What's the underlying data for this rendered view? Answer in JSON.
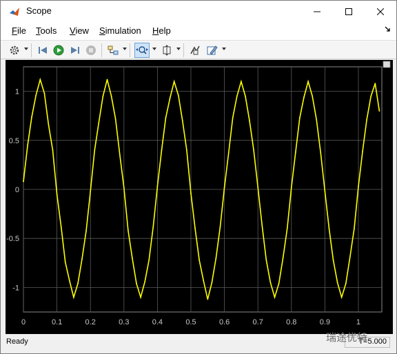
{
  "window": {
    "title": "Scope"
  },
  "menu": [
    {
      "label": "File",
      "underline": "F",
      "rest": "ile"
    },
    {
      "label": "Tools",
      "underline": "T",
      "rest": "ools"
    },
    {
      "label": "View",
      "underline": "V",
      "rest": "iew"
    },
    {
      "label": "Simulation",
      "underline": "S",
      "rest": "imulation"
    },
    {
      "label": "Help",
      "underline": "H",
      "rest": "elp"
    }
  ],
  "toolbar": {
    "icons": [
      "settings-icon",
      "step-back-icon",
      "run-icon",
      "step-forward-icon",
      "stop-icon",
      "signal-selector-icon",
      "zoom-icon",
      "scale-axes-icon",
      "cursor-measure-icon",
      "style-icon"
    ]
  },
  "chart_data": {
    "type": "line",
    "title": "",
    "xlabel": "",
    "ylabel": "",
    "xlim": [
      0,
      1.07
    ],
    "ylim": [
      -1.25,
      1.25
    ],
    "xticks": [
      "0",
      "0.1",
      "0.2",
      "0.3",
      "0.4",
      "0.5",
      "0.6",
      "0.7",
      "0.8",
      "0.9",
      "1"
    ],
    "xtick_values": [
      0,
      0.1,
      0.2,
      0.3,
      0.4,
      0.5,
      0.6,
      0.7,
      0.8,
      0.9,
      1
    ],
    "yticks": [
      "1",
      "0.5",
      "0",
      "-0.5",
      "-1"
    ],
    "ytick_values": [
      1,
      0.5,
      0,
      -0.5,
      -1
    ],
    "grid": true,
    "background": "#000000",
    "grid_color": "#5a5a5a",
    "series": [
      {
        "color": "#ffff00",
        "signal": "noisy sine, amplitude ~1, frequency 5 Hz, noise ~±0.15",
        "x": [
          0,
          0.0125,
          0.025,
          0.0375,
          0.05,
          0.0625,
          0.075,
          0.0875,
          0.1,
          0.1125,
          0.125,
          0.1375,
          0.15,
          0.1625,
          0.175,
          0.1875,
          0.2,
          0.2125,
          0.225,
          0.2375,
          0.25,
          0.2625,
          0.275,
          0.2875,
          0.3,
          0.3125,
          0.325,
          0.3375,
          0.35,
          0.3625,
          0.375,
          0.3875,
          0.4,
          0.4125,
          0.425,
          0.4375,
          0.45,
          0.4625,
          0.475,
          0.4875,
          0.5,
          0.5125,
          0.525,
          0.5375,
          0.55,
          0.5625,
          0.575,
          0.5875,
          0.6,
          0.6125,
          0.625,
          0.6375,
          0.65,
          0.6625,
          0.675,
          0.6875,
          0.7,
          0.7125,
          0.725,
          0.7375,
          0.75,
          0.7625,
          0.775,
          0.7875,
          0.8,
          0.8125,
          0.825,
          0.8375,
          0.85,
          0.8625,
          0.875,
          0.8875,
          0.9,
          0.9125,
          0.925,
          0.9375,
          0.95,
          0.9625,
          0.975,
          0.9875,
          1.0,
          1.0125,
          1.025,
          1.0375,
          1.05,
          1.0625
        ],
        "y": [
          0.08,
          0.45,
          0.74,
          0.96,
          1.12,
          0.98,
          0.66,
          0.4,
          -0.05,
          -0.38,
          -0.74,
          -0.93,
          -1.1,
          -0.96,
          -0.71,
          -0.42,
          -0.02,
          0.4,
          0.68,
          0.95,
          1.12,
          0.95,
          0.72,
          0.36,
          0.02,
          -0.42,
          -0.7,
          -0.96,
          -1.1,
          -0.94,
          -0.72,
          -0.38,
          0.03,
          0.4,
          0.73,
          0.93,
          1.1,
          0.96,
          0.7,
          0.4,
          -0.04,
          -0.4,
          -0.72,
          -0.93,
          -1.12,
          -0.95,
          -0.7,
          -0.38,
          0.02,
          0.37,
          0.73,
          0.95,
          1.1,
          0.95,
          0.7,
          0.4,
          0.02,
          -0.37,
          -0.72,
          -0.95,
          -1.1,
          -0.96,
          -0.7,
          -0.4,
          0.02,
          0.38,
          0.73,
          0.94,
          1.1,
          0.95,
          0.71,
          0.37,
          -0.02,
          -0.4,
          -0.72,
          -0.95,
          -1.1,
          -0.96,
          -0.69,
          -0.4,
          0.03,
          0.39,
          0.71,
          0.95,
          1.08,
          0.8
        ]
      }
    ]
  },
  "status": {
    "text": "Ready",
    "right": "T=5.000"
  },
  "watermark": "瑞途优特"
}
